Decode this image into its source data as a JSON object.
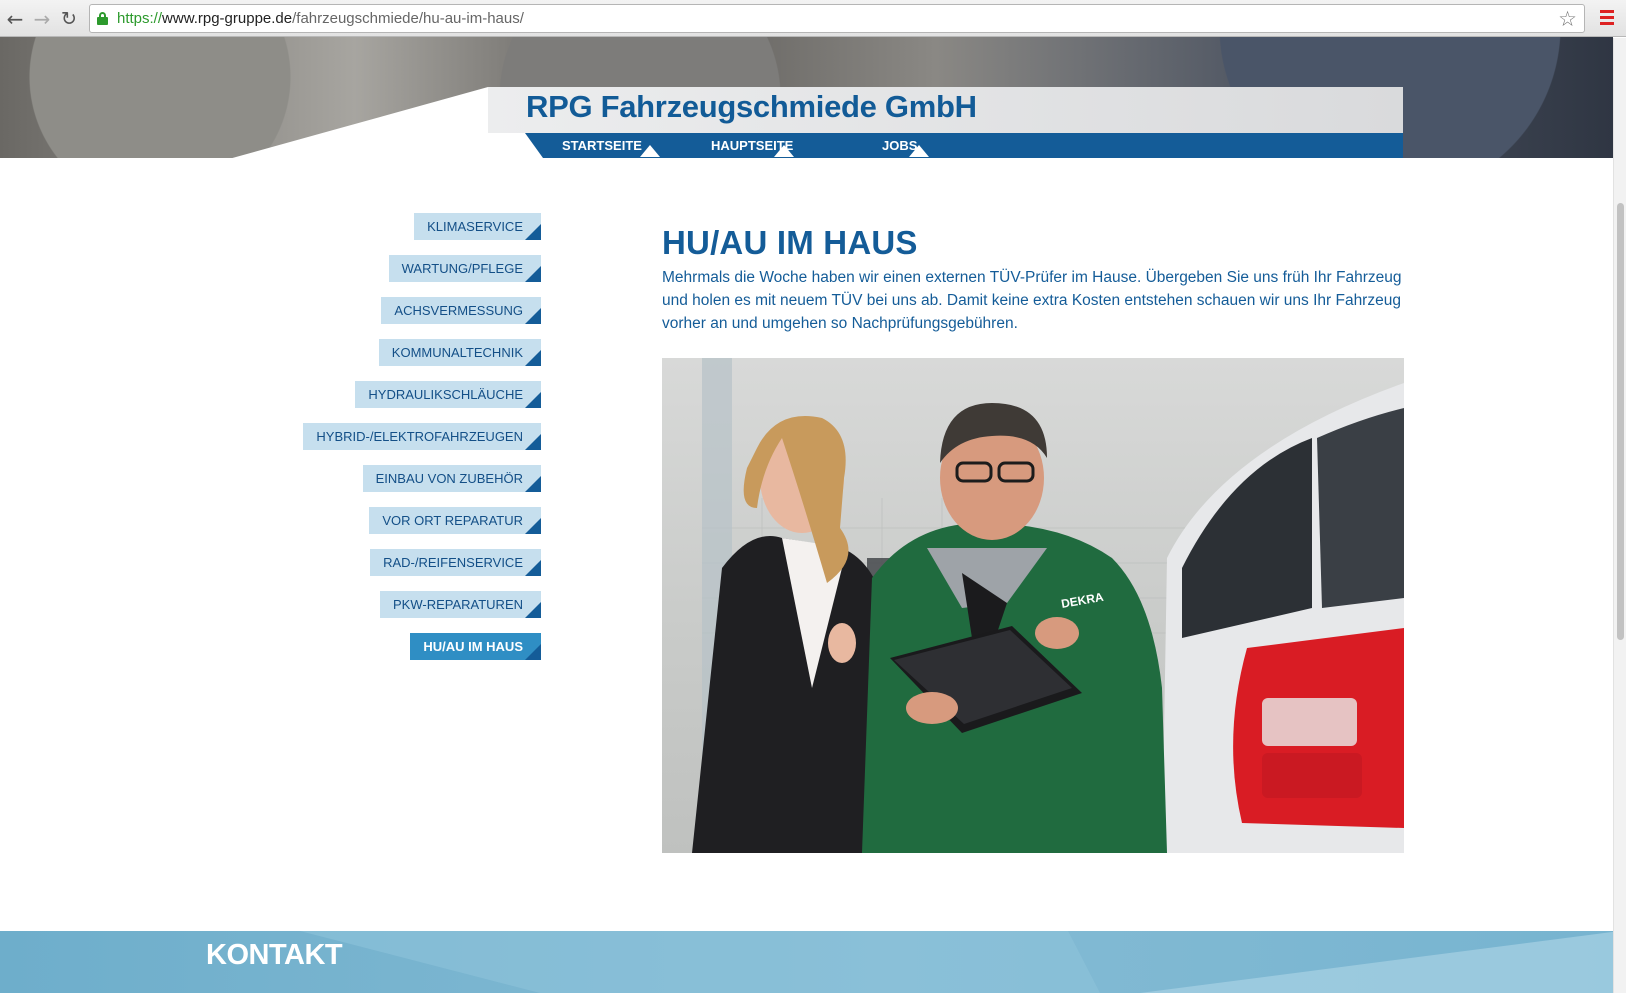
{
  "browser": {
    "url_scheme": "https://",
    "url_host": "www.rpg-gruppe.de",
    "url_path": "/fahrzeugschmiede/hu-au-im-haus/"
  },
  "header": {
    "brand": "RPG Fahrzeugschmiede GmbH",
    "nav": [
      "STARTSEITE",
      "HAUPTSEITE",
      "JOBS"
    ]
  },
  "sidebar": {
    "items": [
      "KLIMASERVICE",
      "WARTUNG/PFLEGE",
      "ACHSVERMESSUNG",
      "KOMMUNALTECHNIK",
      "HYDRAULIKSCHLÄUCHE",
      "HYBRID-/ELEKTROFAHRZEUGEN",
      "EINBAU VON ZUBEHÖR",
      "VOR ORT REPARATUR",
      "RAD-/REIFENSERVICE",
      "PKW-REPARATUREN",
      "HU/AU IM HAUS"
    ],
    "active": "HU/AU IM HAUS"
  },
  "main": {
    "title": "HU/AU IM HAUS",
    "intro": "Mehrmals die Woche haben wir einen externen TÜV-Prüfer im Hause. Übergeben Sie uns früh Ihr Fahrzeug und holen es mit neuem TÜV bei uns ab. Damit keine extra Kosten entstehen schauen wir uns Ihr Fahrzeug vorher an und umgehen so Nachprüfungsgebühren.",
    "photo_jacket_text": "DEKRA"
  },
  "footer": {
    "title": "KONTAKT"
  },
  "colors": {
    "brand_blue": "#145c98",
    "sidebar_bg": "#c6dfee",
    "sidebar_active": "#2f8ec4",
    "footer_bg": "#7db8d2"
  }
}
